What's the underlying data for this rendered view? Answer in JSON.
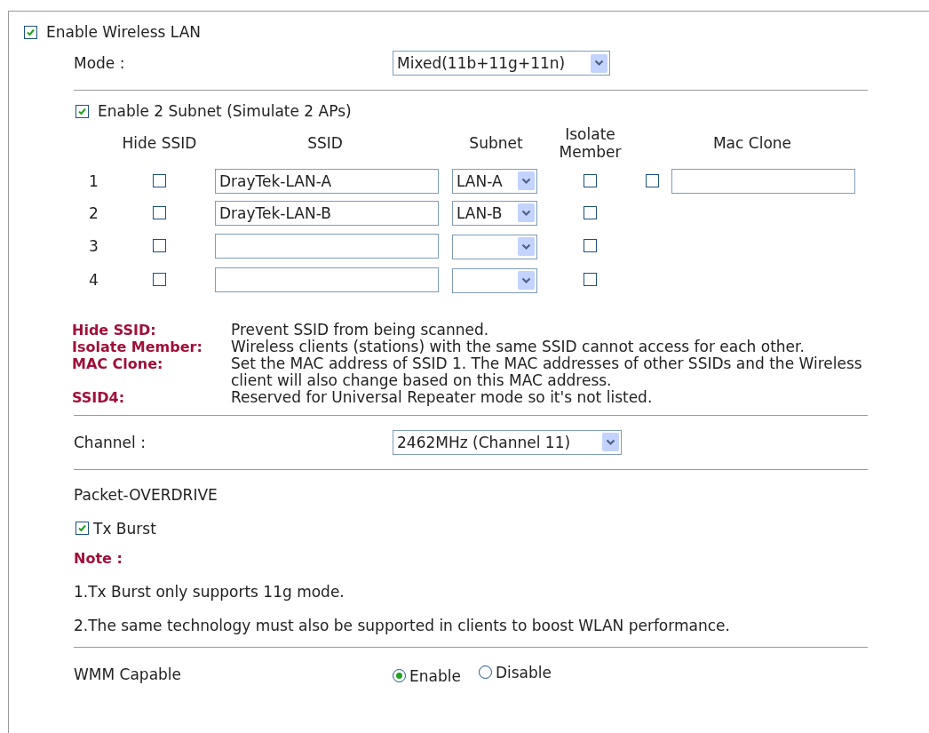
{
  "enable_wireless_lan": {
    "label": "Enable Wireless LAN",
    "checked": true
  },
  "mode": {
    "label": "Mode :",
    "value": "Mixed(11b+11g+11n)"
  },
  "enable_subnet": {
    "label": "Enable 2 Subnet (Simulate 2 APs)",
    "checked": true
  },
  "ssid_table": {
    "columns": [
      "Hide SSID",
      "SSID",
      "Subnet",
      "Isolate Member",
      "Mac Clone"
    ],
    "rows": [
      {
        "index": "1",
        "hide_ssid": false,
        "ssid": "DrayTek-LAN-A",
        "subnet": "LAN-A",
        "isolate_member": false,
        "mac_clone": {
          "checked": false
        }
      },
      {
        "index": "2",
        "hide_ssid": false,
        "ssid": "DrayTek-LAN-B",
        "subnet": "LAN-B",
        "isolate_member": false
      },
      {
        "index": "3",
        "hide_ssid": false,
        "isolate_member": false
      },
      {
        "index": "4",
        "hide_ssid": false,
        "isolate_member": false
      }
    ]
  },
  "notes": [
    {
      "term": "Hide SSID:",
      "text": "Prevent SSID from being scanned."
    },
    {
      "term": "Isolate Member:",
      "text": "Wireless clients (stations) with the same SSID cannot access for each other."
    },
    {
      "term": "MAC Clone:",
      "text": "Set the MAC address of SSID 1. The MAC addresses of other SSIDs and the Wireless client will also change based on this MAC address."
    },
    {
      "term": "SSID4:",
      "text": "Reserved for Universal Repeater mode so it's not listed."
    }
  ],
  "channel": {
    "label": "Channel :",
    "value": "2462MHz (Channel 11)"
  },
  "packet_overdrive": {
    "title": "Packet-OVERDRIVE",
    "tx_burst": {
      "label": "Tx Burst",
      "checked": true
    },
    "note_title": "Note :",
    "notes": [
      "1.Tx Burst only supports 11g mode.",
      "2.The same technology must also be supported in clients to boost WLAN performance."
    ]
  },
  "wmm": {
    "label": "WMM Capable",
    "options": [
      {
        "label": "Enable",
        "selected": true
      },
      {
        "label": "Disable",
        "selected": false
      }
    ]
  }
}
